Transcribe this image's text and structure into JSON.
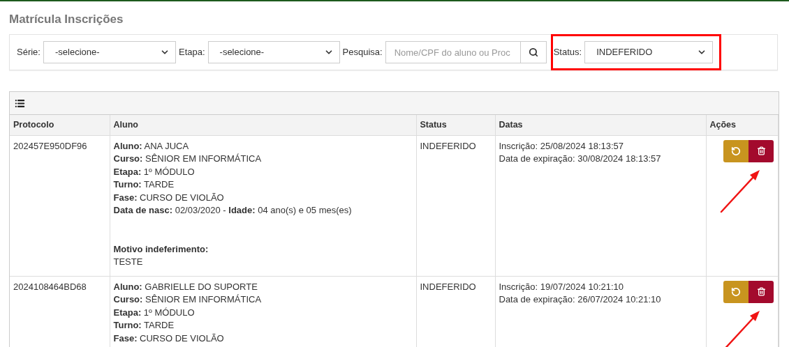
{
  "page_title": "Matrícula Inscrições",
  "filters": {
    "serie": {
      "label": "Série:",
      "value": "-selecione-"
    },
    "etapa": {
      "label": "Etapa:",
      "value": "-selecione-"
    },
    "pesquisa": {
      "label": "Pesquisa:",
      "placeholder": "Nome/CPF do aluno ou Proc"
    },
    "status": {
      "label": "Status:",
      "value": "INDEFERIDO",
      "highlighted": true
    }
  },
  "table": {
    "columns": [
      "Protocolo",
      "Aluno",
      "Status",
      "Datas",
      "Ações"
    ],
    "rows": [
      {
        "protocolo": "202457E950DF96",
        "aluno_lines": [
          "**Aluno:** ANA JUCA",
          "**Curso:** SÊNIOR EM INFORMÁTICA",
          "**Etapa:** 1º MÓDULO",
          "**Turno:** TARDE",
          "**Fase:** CURSO DE VIOLÃO",
          "**Data de nasc:** 02/03/2020 - **Idade:** 04 ano(s) e 05 mes(es)"
        ],
        "motivo_label": "Motivo indeferimento:",
        "motivo": "TESTE",
        "status": "INDEFERIDO",
        "datas": [
          "Inscrição: 25/08/2024 18:13:57",
          "Data de expiração: 30/08/2024 18:13:57"
        ],
        "arrow": true
      },
      {
        "protocolo": "2024108464BD68",
        "aluno_lines": [
          "**Aluno:** GABRIELLE DO SUPORTE",
          "**Curso:** SÊNIOR EM INFORMÁTICA",
          "**Etapa:** 1º MÓDULO",
          "**Turno:** TARDE",
          "**Fase:** CURSO DE VIOLÃO"
        ],
        "status": "INDEFERIDO",
        "datas": [
          "Inscrição: 19/07/2024 10:21:10",
          "Data de expiração: 26/07/2024 10:21:10"
        ],
        "arrow": true
      }
    ]
  }
}
